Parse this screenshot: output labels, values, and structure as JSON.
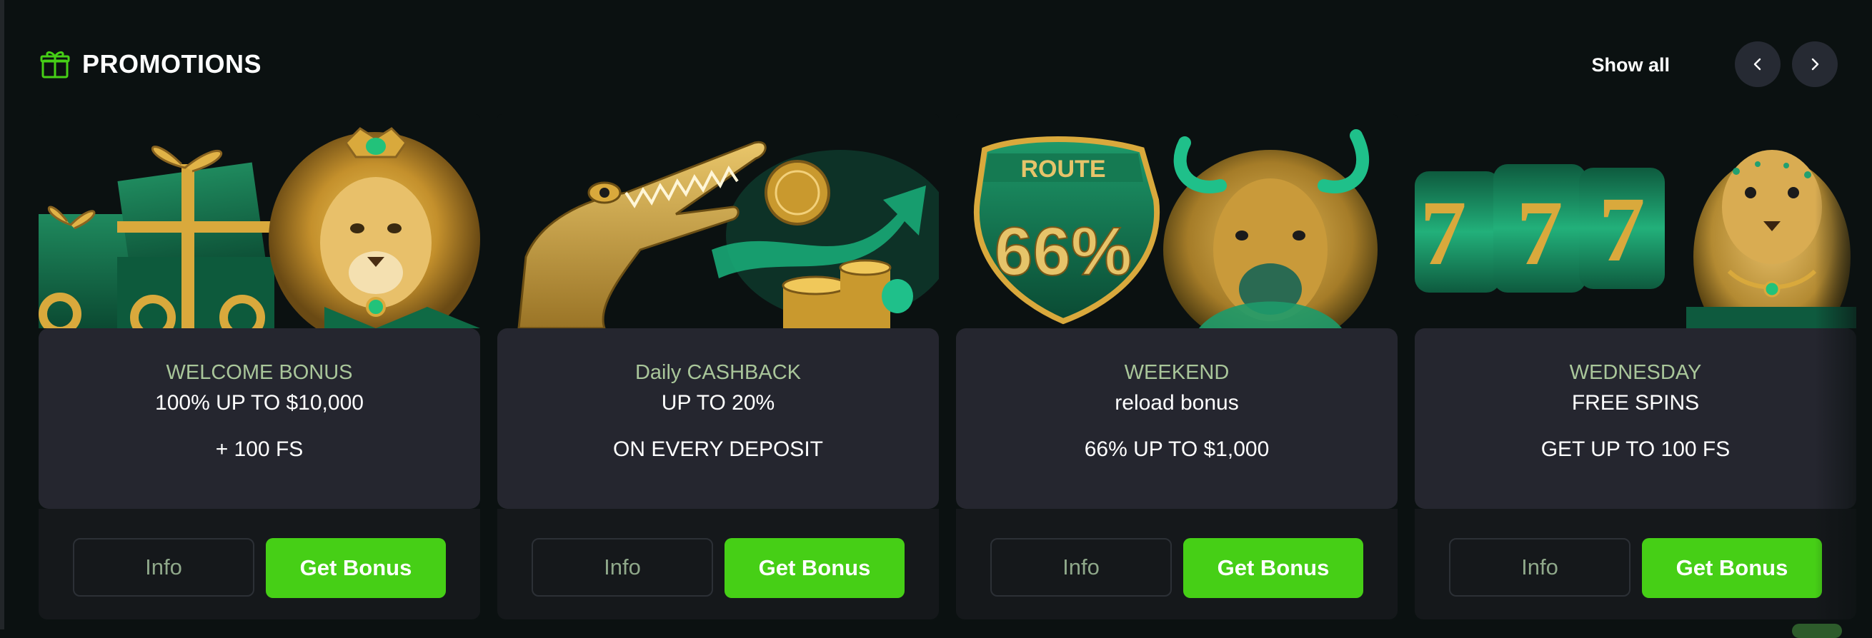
{
  "header": {
    "title": "PROMOTIONS",
    "show_all": "Show all",
    "icon": "gift-icon",
    "prev_icon": "chevron-left-icon",
    "next_icon": "chevron-right-icon"
  },
  "colors": {
    "background": "#0b1111",
    "card_info_bg": "#25262f",
    "card_actions_bg": "#15181b",
    "accent_green": "#46cf16",
    "subtitle_green": "#a9c69a",
    "gift_icon": "#46cf16"
  },
  "promotions": [
    {
      "art": "lion-with-gift-boxes",
      "line1": "WELCOME BONUS",
      "line2": "100% UP TO $10,000",
      "line3": "+ 100 FS",
      "info_label": "Info",
      "bonus_label": "Get Bonus"
    },
    {
      "art": "crocodile-with-coins",
      "line1": "Daily CASHBACK",
      "line2": "UP TO 20%",
      "line3": "ON EVERY DEPOSIT",
      "info_label": "Info",
      "bonus_label": "Get Bonus"
    },
    {
      "art": "buffalo-route-66-sign",
      "line1": "WEEKEND",
      "line2": "reload bonus",
      "line3": "66% UP TO $1,000",
      "info_label": "Info",
      "bonus_label": "Get Bonus",
      "sign_top": "ROUTE",
      "sign_number": "66%"
    },
    {
      "art": "leopard-with-777-reels",
      "line1": "WEDNESDAY",
      "line2": "FREE SPINS",
      "line3": "GET UP TO 100 FS",
      "info_label": "Info",
      "bonus_label": "Get Bonus",
      "reel_symbols": [
        "7",
        "7",
        "7"
      ]
    }
  ]
}
